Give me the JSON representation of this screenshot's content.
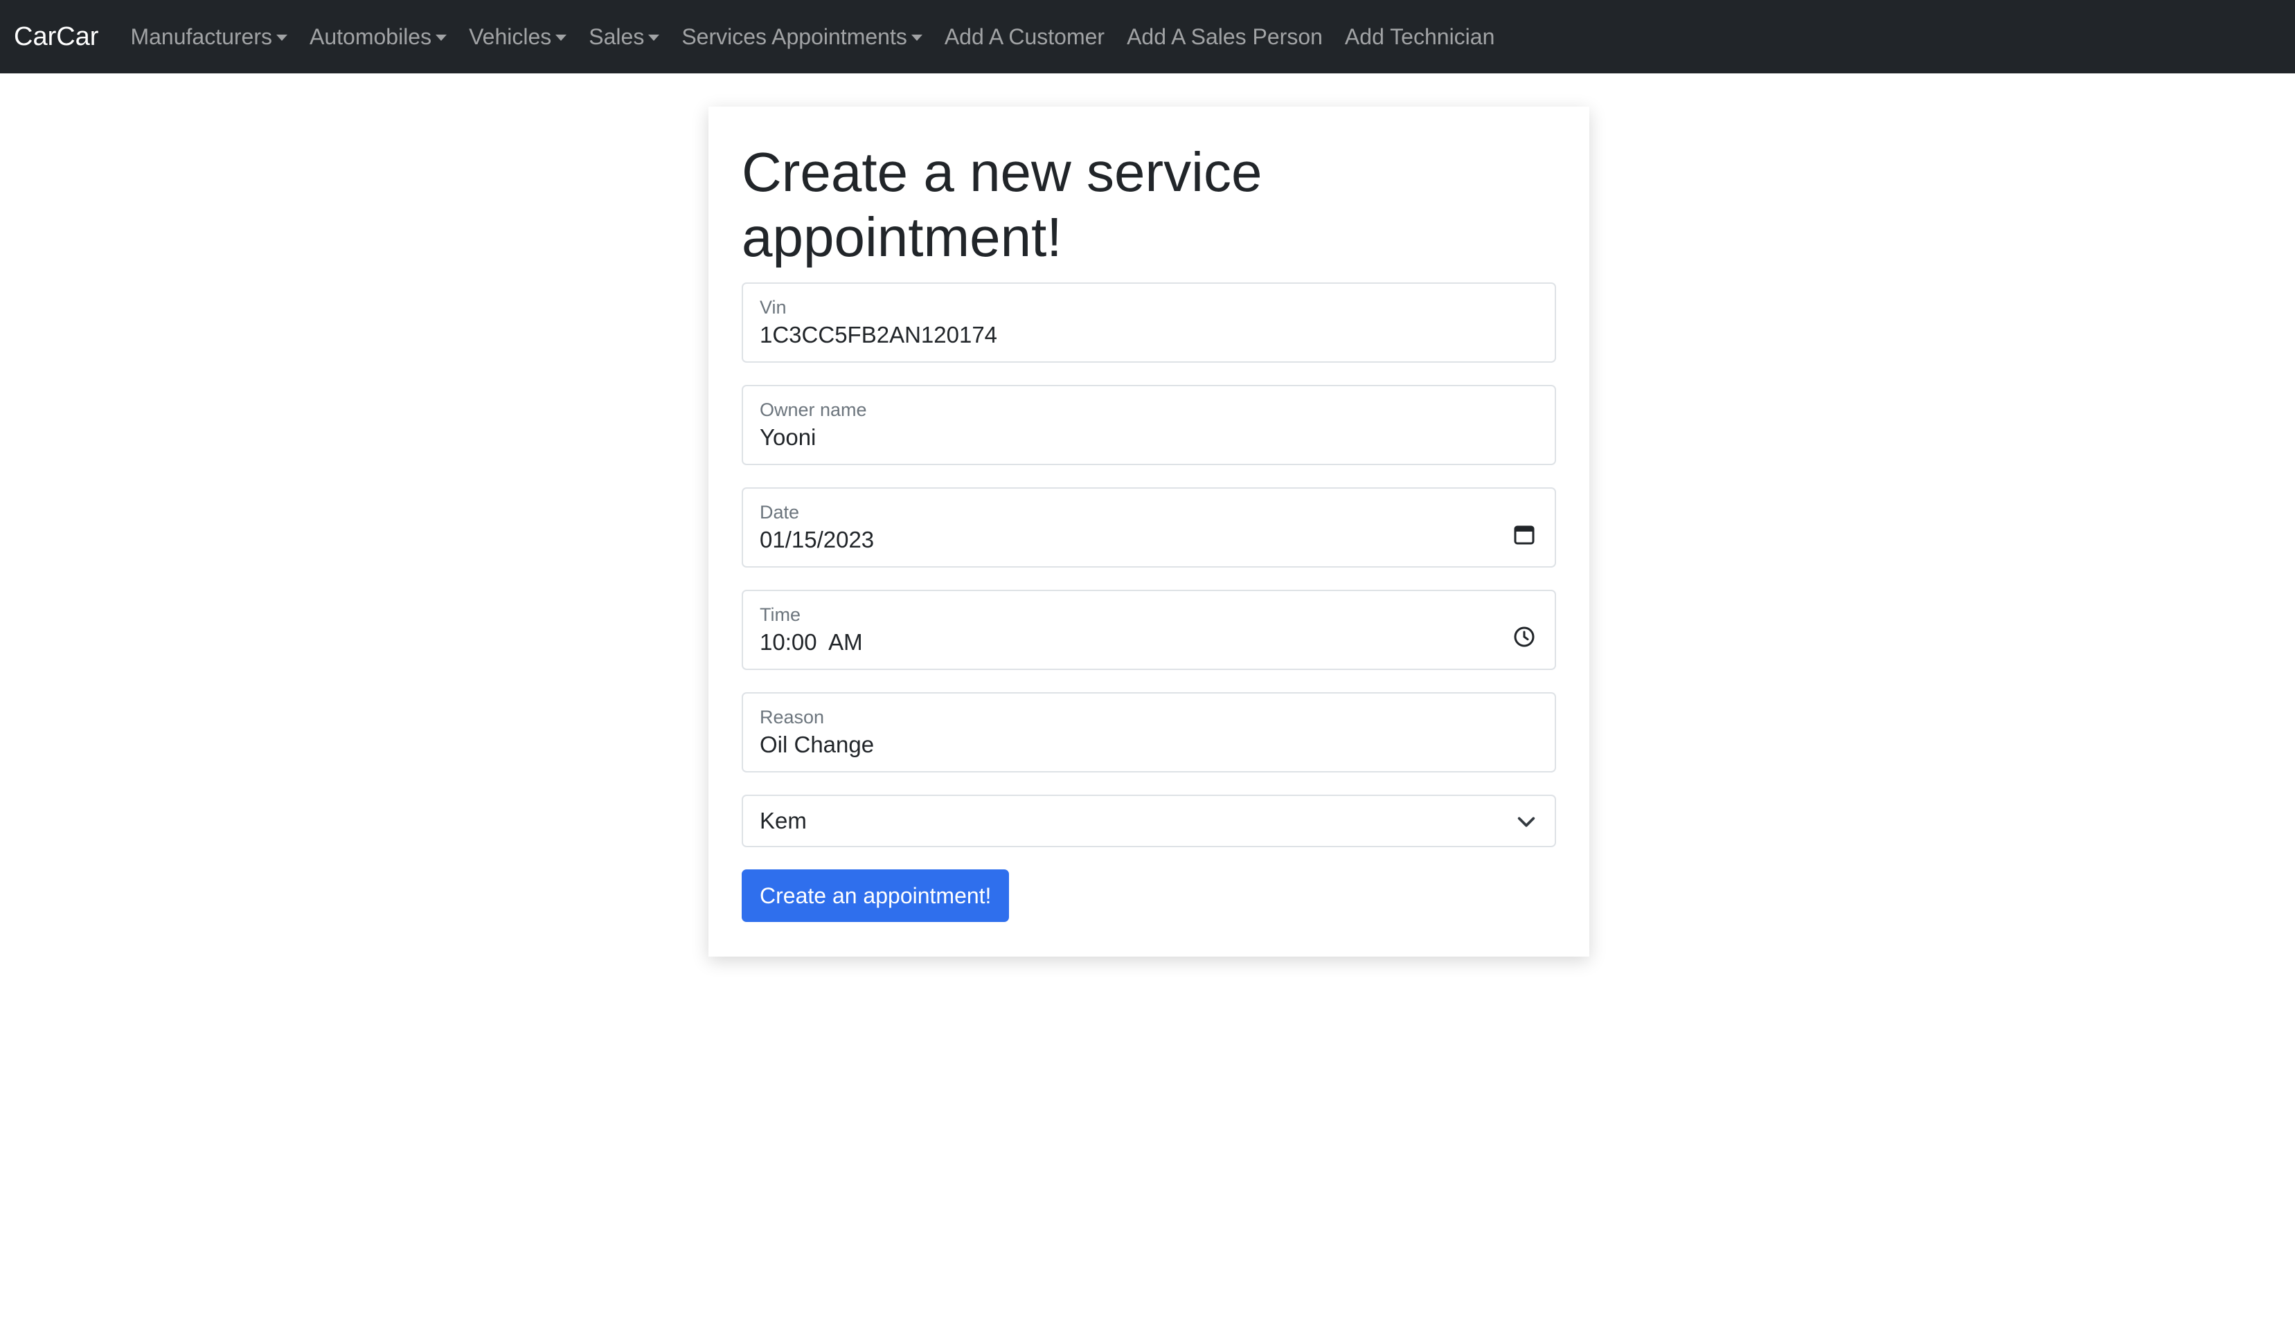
{
  "navbar": {
    "brand": "CarCar",
    "items": [
      {
        "label": "Manufacturers",
        "dropdown": true
      },
      {
        "label": "Automobiles",
        "dropdown": true
      },
      {
        "label": "Vehicles",
        "dropdown": true
      },
      {
        "label": "Sales",
        "dropdown": true
      },
      {
        "label": "Services Appointments",
        "dropdown": true
      },
      {
        "label": "Add A Customer",
        "dropdown": false
      },
      {
        "label": "Add A Sales Person",
        "dropdown": false
      },
      {
        "label": "Add Technician",
        "dropdown": false
      }
    ]
  },
  "form": {
    "title": "Create a new service appointment!",
    "vin": {
      "label": "Vin",
      "value": "1C3CC5FB2AN120174"
    },
    "owner": {
      "label": "Owner name",
      "value": "Yooni"
    },
    "date": {
      "label": "Date",
      "value": "01/15/2023",
      "icon": "calendar-icon"
    },
    "time": {
      "label": "Time",
      "value": "10:00  AM",
      "icon": "clock-icon"
    },
    "reason": {
      "label": "Reason",
      "value": "Oil Change"
    },
    "technician": {
      "selected": "Kem",
      "icon": "chevron-down-icon"
    },
    "submit_label": "Create an appointment!"
  },
  "colors": {
    "navbar_bg": "#212529",
    "button_bg": "#2f6fed",
    "card_bg": "#ffffff"
  }
}
